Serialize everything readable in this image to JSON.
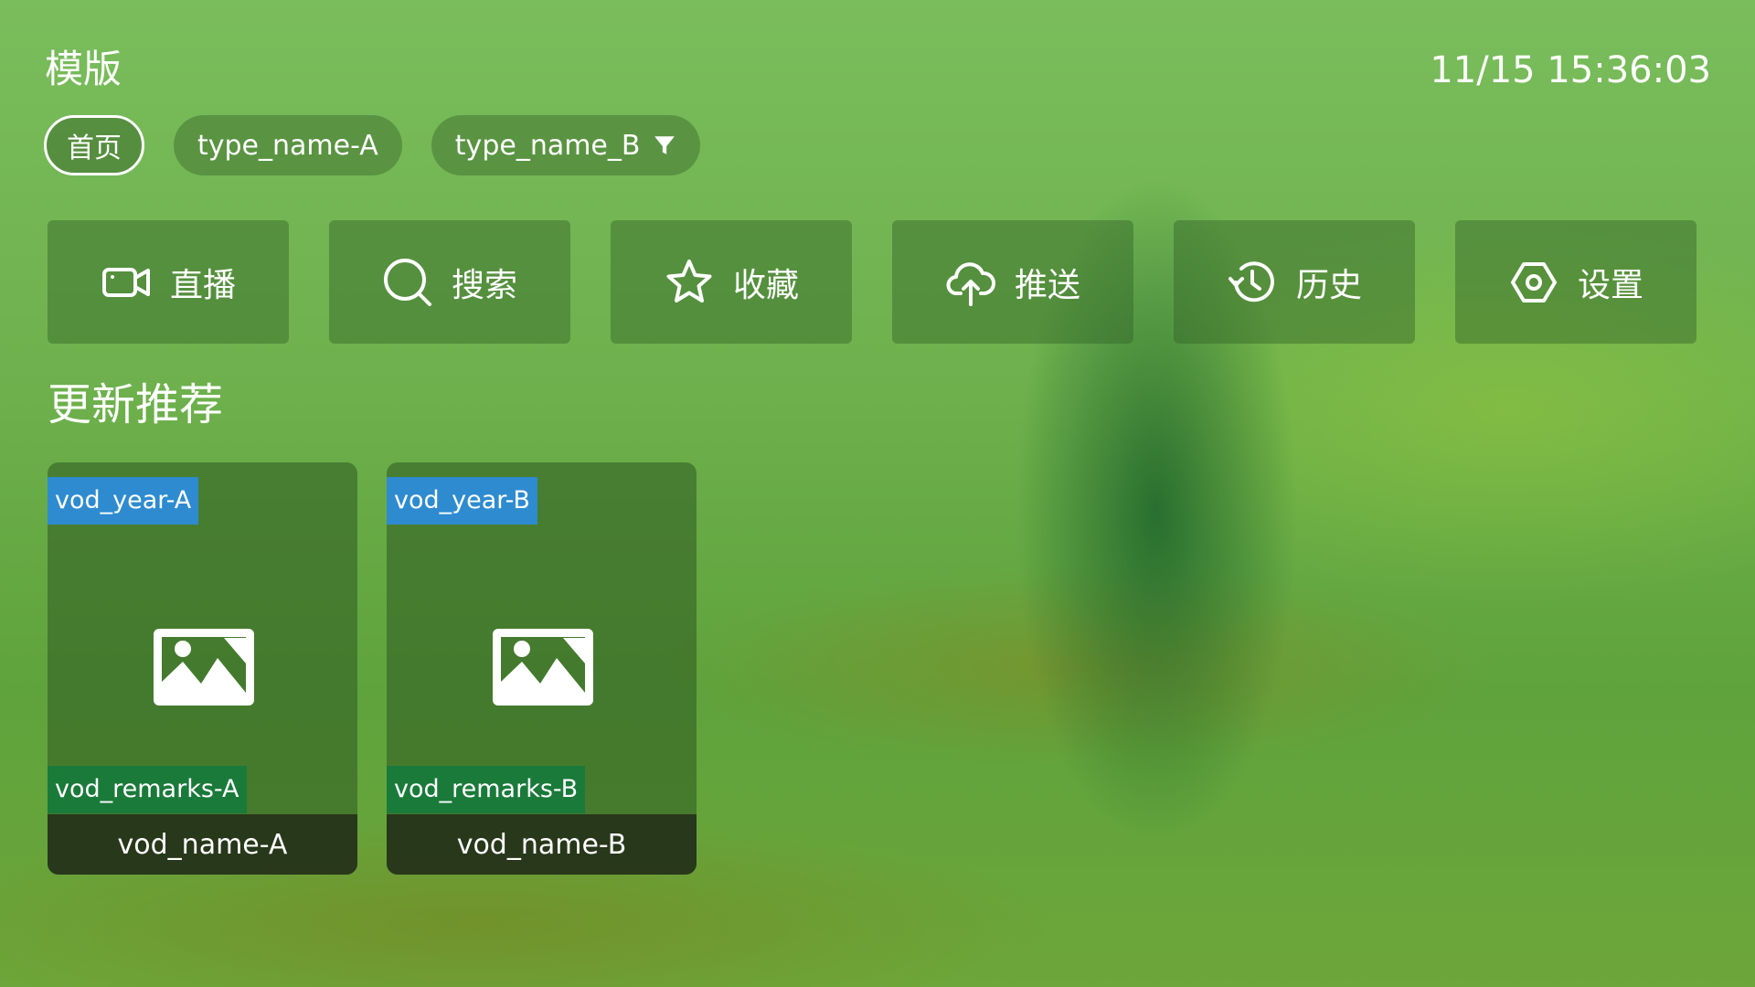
{
  "header": {
    "title": "模版",
    "clock": "11/15 15:36:03"
  },
  "tabs": [
    {
      "label": "首页",
      "active": true
    },
    {
      "label": "type_name-A",
      "active": false
    },
    {
      "label": "type_name_B",
      "active": false,
      "icon": "filter-icon"
    }
  ],
  "actions": [
    {
      "label": "直播",
      "icon": "video-camera-icon"
    },
    {
      "label": "搜索",
      "icon": "search-icon"
    },
    {
      "label": "收藏",
      "icon": "star-icon"
    },
    {
      "label": "推送",
      "icon": "cloud-upload-icon"
    },
    {
      "label": "历史",
      "icon": "history-icon"
    },
    {
      "label": "设置",
      "icon": "settings-icon"
    }
  ],
  "section": {
    "title": "更新推荐"
  },
  "cards": [
    {
      "year": "vod_year-A",
      "remarks": "vod_remarks-A",
      "name": "vod_name-A",
      "icon": "image-placeholder-icon"
    },
    {
      "year": "vod_year-B",
      "remarks": "vod_remarks-B",
      "name": "vod_name-B",
      "icon": "image-placeholder-icon"
    }
  ],
  "colors": {
    "year_badge": "#2e8bd0",
    "remarks_badge": "#1a7a3a"
  }
}
